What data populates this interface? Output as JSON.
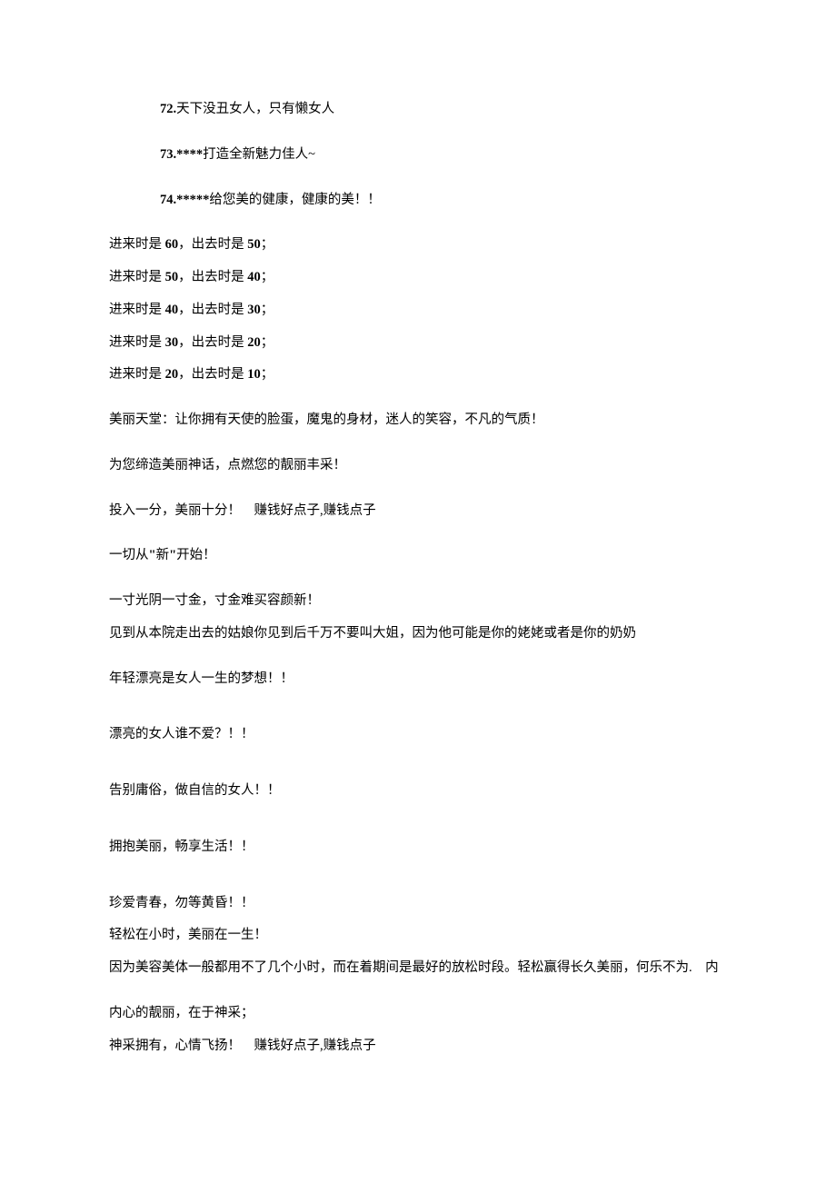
{
  "numbered": [
    {
      "prefix": "72.",
      "text": "天下没丑女人，只有懒女人"
    },
    {
      "prefix": "73.****",
      "text": "打造全新魅力佳人~"
    },
    {
      "prefix": "74.*****",
      "text": "给您美的健康，健康的美！！"
    }
  ],
  "pairs": [
    {
      "a": "60",
      "b": "50"
    },
    {
      "a": "50",
      "b": "40"
    },
    {
      "a": "40",
      "b": "30"
    },
    {
      "a": "30",
      "b": "20"
    },
    {
      "a": "20",
      "b": "10"
    }
  ],
  "pair_tpl": {
    "p1": "进来时是 ",
    "p2": "，出去时是 ",
    "p3": "；"
  },
  "lines": {
    "l1": "美丽天堂：让你拥有天使的脸蛋，魔鬼的身材，迷人的笑容，不凡的气质！",
    "l2": "为您缔造美丽神话，点燃您的靓丽丰采！",
    "l3": "投入一分，美丽十分！　赚钱好点子,赚钱点子",
    "l4a": "一切从",
    "l4q1": "\"",
    "l4b": "新",
    "l4q2": "\"",
    "l4c": "开始！",
    "l5": "一寸光阴一寸金，寸金难买容颜新！",
    "l6": "见到从本院走出去的姑娘你见到后千万不要叫大姐，因为他可能是你的姥姥或者是你的奶奶",
    "l7": "年轻漂亮是女人一生的梦想！！",
    "l8": "漂亮的女人谁不爱？！！",
    "l9": "告别庸俗，做自信的女人！！",
    "l10": "拥抱美丽，畅享生活！！",
    "l11": "珍爱青春，勿等黄昏！！",
    "l12": "轻松在小时，美丽在一生！",
    "l13": "因为美容美体一般都用不了几个小时，而在着期间是最好的放松时段。轻松赢得长久美丽，何乐不为.　内",
    "l14": "内心的靓丽，在于神采；",
    "l15": "神采拥有，心情飞扬！　赚钱好点子,赚钱点子"
  }
}
